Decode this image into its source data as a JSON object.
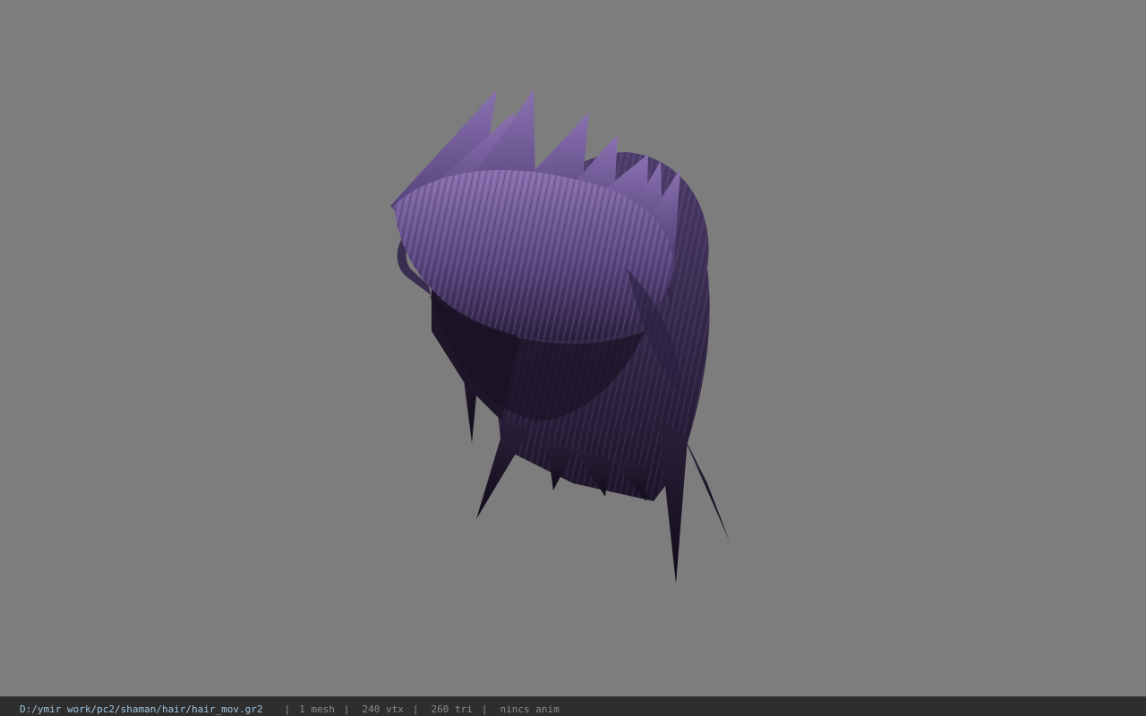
{
  "status_bar": {
    "file_path": "D:/ymir work/pc2/shaman/hair/hair_mov.gr2",
    "separator": "|",
    "mesh_count": "1 mesh",
    "vertex_count": "240 vtx",
    "triangle_count": "260 tri",
    "anim_status": "nincs anim"
  },
  "colors": {
    "viewport_background": "#7d7d7d",
    "status_bar_background": "#2e2e2e",
    "path_text": "#9fc4e0",
    "info_text": "#8c8c8c",
    "hair_light": "#8a72b0",
    "hair_dark": "#1c1428"
  }
}
